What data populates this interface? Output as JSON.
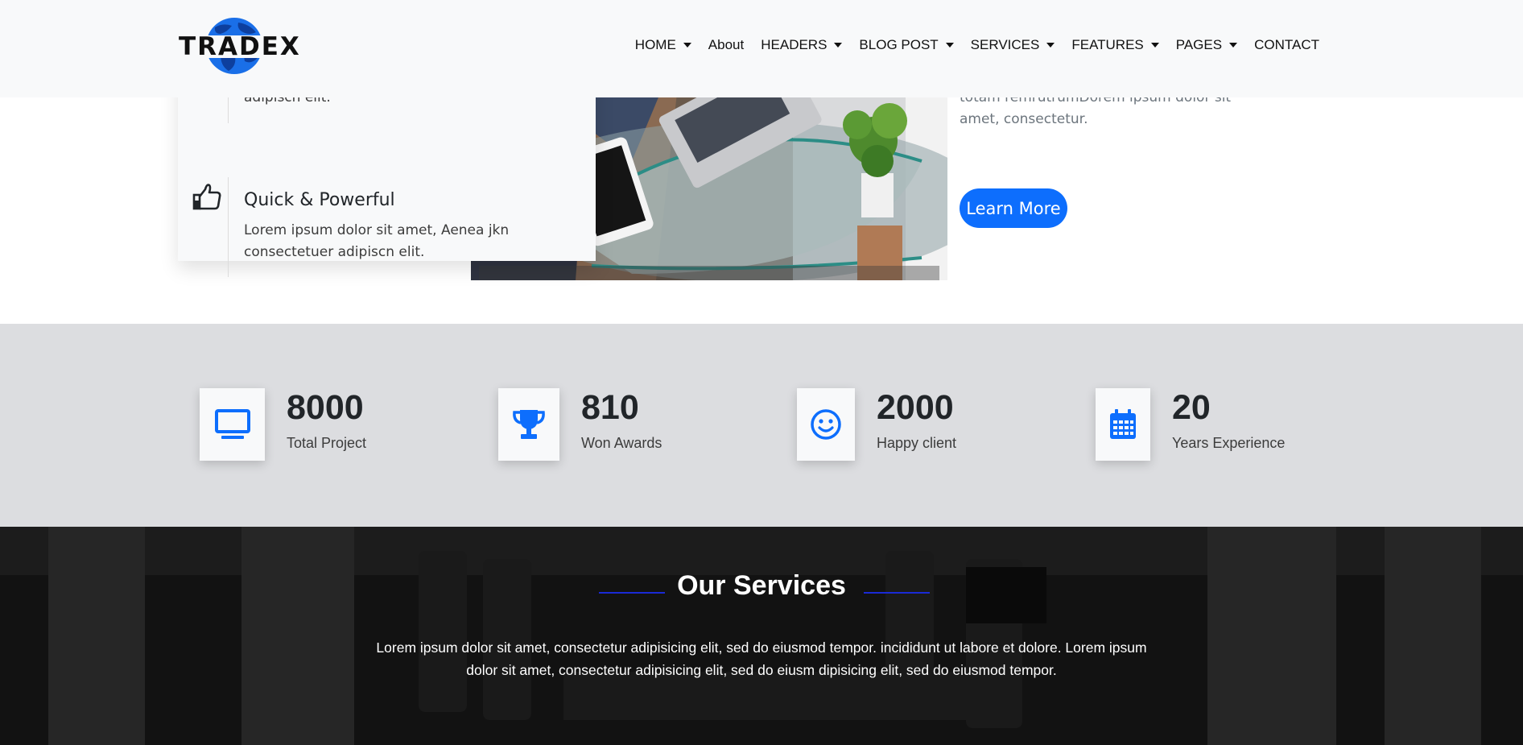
{
  "brand": {
    "name": "TRADEX",
    "accent": "#0d6efd"
  },
  "nav": {
    "items": [
      {
        "label": "HOME",
        "dropdown": true
      },
      {
        "label": "About",
        "dropdown": false
      },
      {
        "label": "HEADERS",
        "dropdown": true
      },
      {
        "label": "BLOG POST",
        "dropdown": true
      },
      {
        "label": "SERVICES",
        "dropdown": true
      },
      {
        "label": "FEATURES",
        "dropdown": true
      },
      {
        "label": "PAGES",
        "dropdown": true
      },
      {
        "label": "CONTACT",
        "dropdown": false
      }
    ]
  },
  "features": {
    "items": [
      {
        "title": "",
        "desc": "adipiscn elit.",
        "icon": "feature-icon"
      },
      {
        "title": "Quick & Powerful",
        "desc": "Lorem ipsum dolor sit amet, Aenea jkn consectetuer adipiscn elit.",
        "icon": "thumbs-up-icon"
      }
    ]
  },
  "about": {
    "text": "totam remrutrumDorem ipsum dolor sit amet, consectetur.",
    "button_label": "Learn More"
  },
  "stats": {
    "items": [
      {
        "value": "8000",
        "label": "Total Project",
        "icon": "monitor-icon"
      },
      {
        "value": "810",
        "label": "Won Awards",
        "icon": "trophy-icon"
      },
      {
        "value": "2000",
        "label": "Happy client",
        "icon": "smiley-icon"
      },
      {
        "value": "20",
        "label": "Years Experience",
        "icon": "calendar-icon"
      }
    ]
  },
  "services": {
    "title": "Our Services",
    "desc": "Lorem ipsum dolor sit amet, consectetur adipisicing elit, sed do eiusmod tempor. incididunt ut labore et dolore. Lorem ipsum dolor sit amet, consectetur adipisicing elit, sed do eiusm dipisicing elit, sed do eiusmod tempor."
  }
}
